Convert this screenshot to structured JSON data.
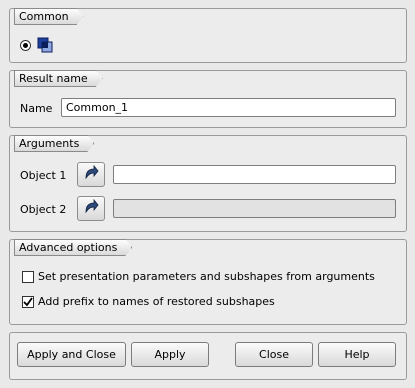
{
  "sections": {
    "common": {
      "title": "Common"
    },
    "result_name": {
      "title": "Result name",
      "name_label": "Name",
      "name_value": "Common_1"
    },
    "arguments": {
      "title": "Arguments",
      "object1_label": "Object 1",
      "object1_value": "",
      "object2_label": "Object 2",
      "object2_value": ""
    },
    "advanced": {
      "title": "Advanced options",
      "option1_label": "Set presentation parameters and subshapes from arguments",
      "option1_checked": false,
      "option2_label": "Add prefix to names of restored subshapes",
      "option2_checked": true
    }
  },
  "buttons": {
    "apply_close": "Apply and Close",
    "apply": "Apply",
    "close": "Close",
    "help": "Help"
  },
  "icons": {
    "operation": "common-boolean-icon",
    "select": "selection-arrow-icon"
  }
}
